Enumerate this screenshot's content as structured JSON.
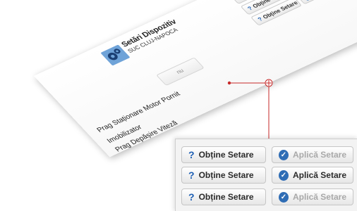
{
  "card": {
    "title": "Setări Dispozitiv",
    "subtitle": "SUC CLUJ-NAPOCA",
    "labels": [
      "Prag Staționare Motor Pornit",
      "Imobilizator",
      "Prag Depășire Viteză"
    ],
    "value_nu": "nu"
  },
  "buttons": {
    "get_label": "Obține Setare",
    "apply_label": "Aplică Setare"
  },
  "rows": [
    {
      "apply_enabled": false
    },
    {
      "apply_enabled": true
    },
    {
      "apply_enabled": false
    }
  ],
  "colors": {
    "icon_blue": "#2f6db5",
    "connector_red": "#c62828"
  }
}
